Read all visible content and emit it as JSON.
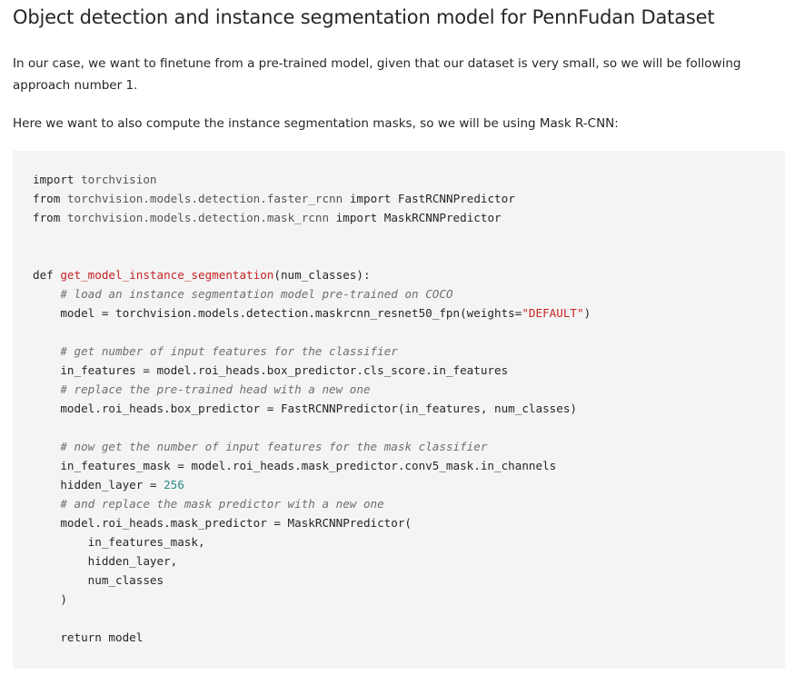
{
  "heading": "Object detection and instance segmentation model for PennFudan Dataset",
  "paragraphs": [
    "In our case, we want to finetune from a pre-trained model, given that our dataset is very small, so we will be following approach number 1.",
    "Here we want to also compute the instance segmentation masks, so we will be using Mask R-CNN:"
  ],
  "colors": {
    "code_background": "#f4f4f4",
    "function_name": "#c72323",
    "string": "#c72323",
    "number": "#2a8a84",
    "comment": "#6e6e6e"
  },
  "code": {
    "language": "python",
    "lines": [
      [
        {
          "t": "kw",
          "v": "import"
        },
        {
          "t": "pl",
          "v": " "
        },
        {
          "t": "mod",
          "v": "torchvision"
        }
      ],
      [
        {
          "t": "kw",
          "v": "from"
        },
        {
          "t": "pl",
          "v": " "
        },
        {
          "t": "mod",
          "v": "torchvision.models.detection.faster_rcnn"
        },
        {
          "t": "pl",
          "v": " "
        },
        {
          "t": "kw",
          "v": "import"
        },
        {
          "t": "pl",
          "v": " FastRCNNPredictor"
        }
      ],
      [
        {
          "t": "kw",
          "v": "from"
        },
        {
          "t": "pl",
          "v": " "
        },
        {
          "t": "mod",
          "v": "torchvision.models.detection.mask_rcnn"
        },
        {
          "t": "pl",
          "v": " "
        },
        {
          "t": "kw",
          "v": "import"
        },
        {
          "t": "pl",
          "v": " MaskRCNNPredictor"
        }
      ],
      [],
      [],
      [
        {
          "t": "kw",
          "v": "def"
        },
        {
          "t": "pl",
          "v": " "
        },
        {
          "t": "fn",
          "v": "get_model_instance_segmentation"
        },
        {
          "t": "pl",
          "v": "(num_classes):"
        }
      ],
      [
        {
          "t": "pl",
          "v": "    "
        },
        {
          "t": "cm",
          "v": "# load an instance segmentation model pre-trained on COCO"
        }
      ],
      [
        {
          "t": "pl",
          "v": "    model = torchvision.models.detection.maskrcnn_resnet50_fpn(weights="
        },
        {
          "t": "str",
          "v": "\"DEFAULT\""
        },
        {
          "t": "pl",
          "v": ")"
        }
      ],
      [],
      [
        {
          "t": "pl",
          "v": "    "
        },
        {
          "t": "cm",
          "v": "# get number of input features for the classifier"
        }
      ],
      [
        {
          "t": "pl",
          "v": "    in_features = model.roi_heads.box_predictor.cls_score.in_features"
        }
      ],
      [
        {
          "t": "pl",
          "v": "    "
        },
        {
          "t": "cm",
          "v": "# replace the pre-trained head with a new one"
        }
      ],
      [
        {
          "t": "pl",
          "v": "    model.roi_heads.box_predictor = FastRCNNPredictor(in_features, num_classes)"
        }
      ],
      [],
      [
        {
          "t": "pl",
          "v": "    "
        },
        {
          "t": "cm",
          "v": "# now get the number of input features for the mask classifier"
        }
      ],
      [
        {
          "t": "pl",
          "v": "    in_features_mask = model.roi_heads.mask_predictor.conv5_mask.in_channels"
        }
      ],
      [
        {
          "t": "pl",
          "v": "    hidden_layer = "
        },
        {
          "t": "num",
          "v": "256"
        }
      ],
      [
        {
          "t": "pl",
          "v": "    "
        },
        {
          "t": "cm",
          "v": "# and replace the mask predictor with a new one"
        }
      ],
      [
        {
          "t": "pl",
          "v": "    model.roi_heads.mask_predictor = MaskRCNNPredictor("
        }
      ],
      [
        {
          "t": "pl",
          "v": "        in_features_mask,"
        }
      ],
      [
        {
          "t": "pl",
          "v": "        hidden_layer,"
        }
      ],
      [
        {
          "t": "pl",
          "v": "        num_classes"
        }
      ],
      [
        {
          "t": "pl",
          "v": "    )"
        }
      ],
      [],
      [
        {
          "t": "pl",
          "v": "    "
        },
        {
          "t": "kw",
          "v": "return"
        },
        {
          "t": "pl",
          "v": " model"
        }
      ]
    ]
  }
}
